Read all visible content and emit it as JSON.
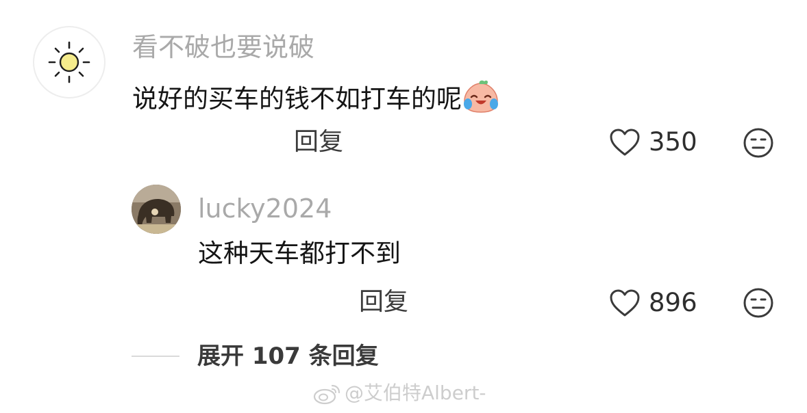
{
  "comment": {
    "username": "看不破也要说破",
    "text": "说好的买车的钱不如打车的呢",
    "emoji": "crying-laughing-peach-emoji",
    "reply_label": "回复",
    "likes": "350"
  },
  "reply": {
    "username": "lucky2024",
    "text": "这种天车都打不到",
    "reply_label": "回复",
    "likes": "896"
  },
  "expand": {
    "label": "展开 107 条回复"
  },
  "watermark": {
    "text": "@艾伯特Albert-"
  },
  "icons": {
    "main_avatar": "sun-icon",
    "like": "heart-icon",
    "dislike": "meh-face-icon",
    "watermark": "weibo-icon"
  },
  "colors": {
    "username": "#a9a9a9",
    "text": "#151515",
    "icon": "#3a3a3a"
  }
}
